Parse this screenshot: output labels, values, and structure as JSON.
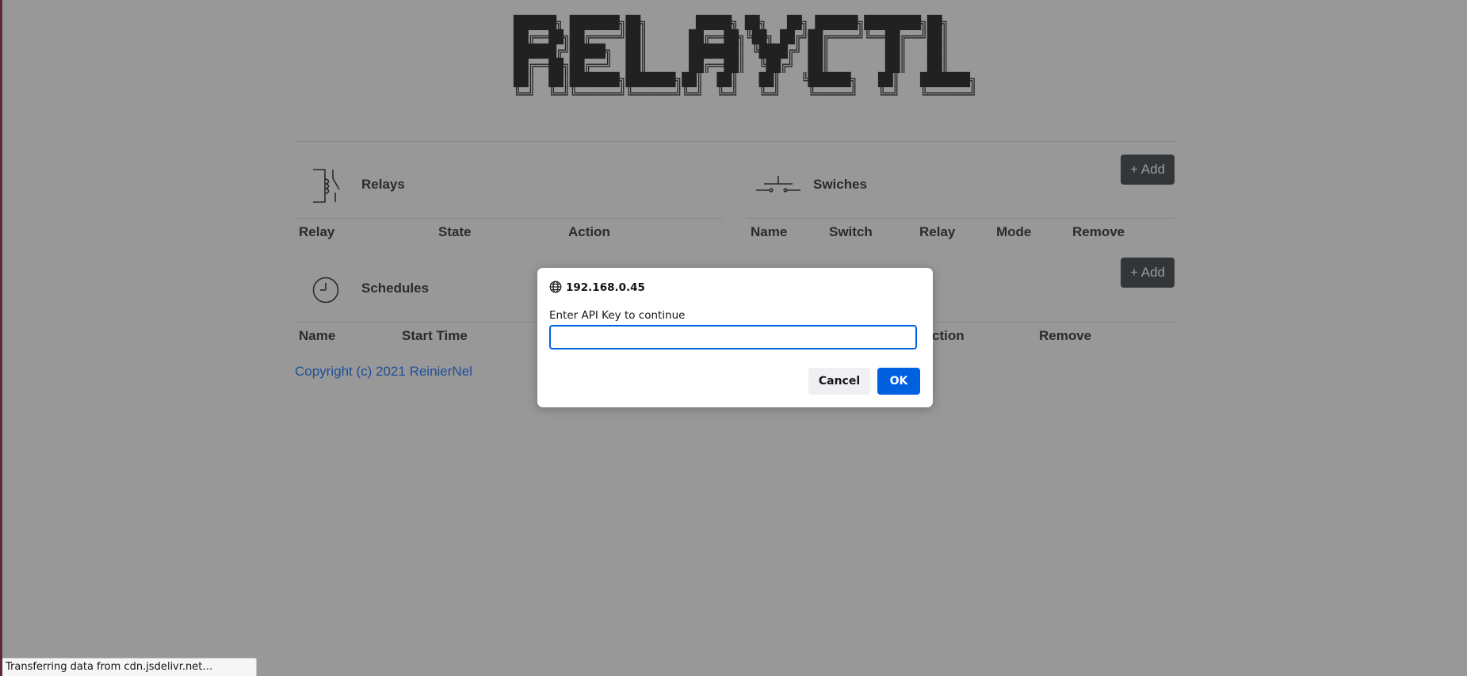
{
  "app": {
    "banner_ascii": "██████╗ ███████╗██╗       █████╗ ██╗   ██╗ ██████╗████████╗██╗\n██╔══██╗██╔════╝██║      ██╔══██╗╚██╗ ██╔╝██╔════╝╚══██╔══╝██║\n██████╔╝█████╗  ██║      ███████║ ╚████╔╝ ██║        ██║   ██║\n██╔══██╗██╔══╝  ██║      ██╔══██║  ╚██╔╝  ██║        ██║   ██║\n██║  ██║███████╗███████╗██║  ██║   ██║   ╚██████╗   ██║   ███████╗\n╚═╝  ╚═╝╚══════╝╚══════╝╚═╝  ╚═╝   ╚═╝    ╚═════╝   ╚═╝   ╚══════╝",
    "copyright": "Copyright (c) 2021 ReinierNel"
  },
  "relays": {
    "title": "Relays",
    "icon": "relay-icon",
    "columns": [
      "Relay",
      "State",
      "Action"
    ]
  },
  "switches": {
    "title": "Swiches",
    "icon": "switch-icon",
    "add_label": "+ Add",
    "columns": [
      "Name",
      "Switch",
      "Relay",
      "Mode",
      "Remove"
    ]
  },
  "schedules": {
    "title": "Schedules",
    "icon": "clock-icon",
    "add_label": "+ Add",
    "columns": [
      "Name",
      "Start Time",
      "",
      "ction",
      "Remove"
    ]
  },
  "dialog": {
    "origin": "192.168.0.45",
    "message": "Enter API Key to continue",
    "input_value": "",
    "cancel_label": "Cancel",
    "ok_label": "OK",
    "accent": "#0061e0"
  },
  "statusbar": {
    "text": "Transferring data from cdn.jsdelivr.net…"
  },
  "colors": {
    "add_button": "#343a40",
    "link": "#0d6efd",
    "overlay": "rgba(50,50,50,0.5)"
  }
}
